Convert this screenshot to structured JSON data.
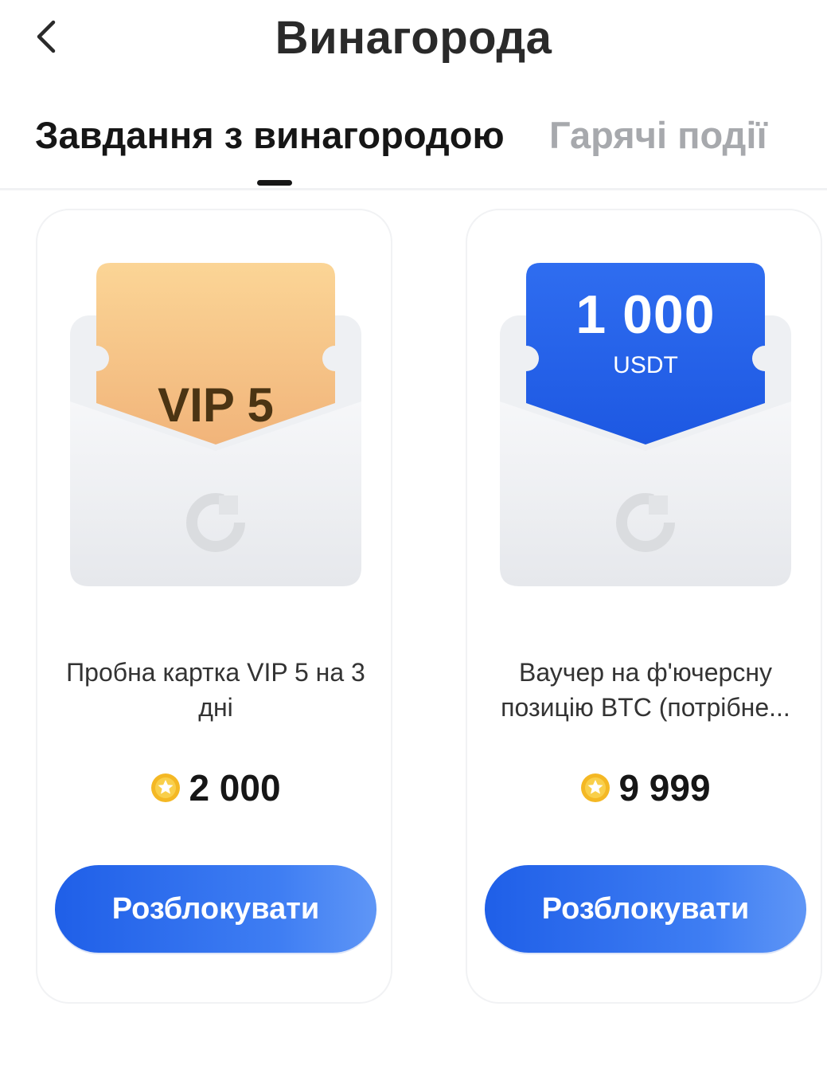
{
  "header": {
    "title": "Винагорода",
    "back_icon": "chevron-left-icon"
  },
  "tabs": [
    {
      "label": "Завдання з винагородою",
      "active": true
    },
    {
      "label": "Гарячі події",
      "active": false
    }
  ],
  "cards": [
    {
      "ticket_label": "VIP 5",
      "ticket_color": "#f6c48a",
      "description": "Пробна картка VIP 5 на 3 дні",
      "price": "2 000",
      "coin_icon": "coin-star-icon",
      "button_label": "Розблокувати"
    },
    {
      "ticket_amount": "1 000",
      "ticket_unit": "USDT",
      "ticket_color": "#2a66ea",
      "description": "Ваучер на ф'ючерсну позицію BTC (потрібне...",
      "price": "9 999",
      "coin_icon": "coin-star-icon",
      "button_label": "Розблокувати"
    }
  ],
  "colors": {
    "accent": "#2a66ea",
    "coin": "#f4b824"
  }
}
